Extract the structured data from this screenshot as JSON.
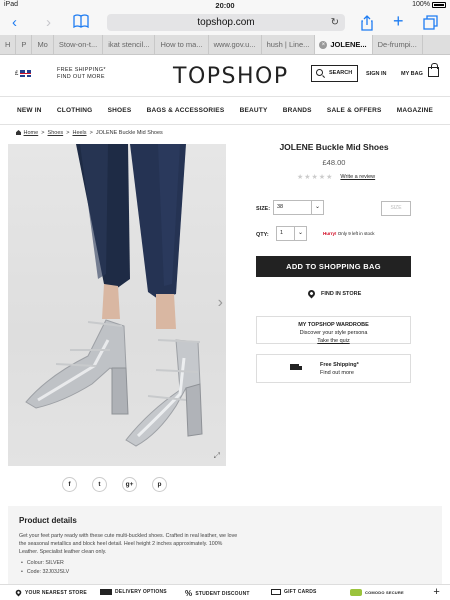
{
  "status_bar": {
    "carrier": "iPad",
    "time": "20:00",
    "battery": "100%"
  },
  "browser": {
    "url": "topshop.com",
    "tabs": [
      "H",
      "P",
      "Mo",
      "Stow-on-t...",
      "ikat stencil...",
      "How to ma...",
      "www.gov.u...",
      "hush | Line...",
      "JOLENE...",
      "De-frumpi..."
    ],
    "active_tab_index": 8
  },
  "header": {
    "currency": "£",
    "shipping_promo_line1": "FREE SHIPPING*",
    "shipping_promo_line2": "FIND OUT MORE",
    "logo": "TOPSHOP",
    "search_label": "SEARCH",
    "signin_label": "SIGN IN",
    "bag_label": "MY BAG"
  },
  "nav": [
    "NEW IN",
    "CLOTHING",
    "SHOES",
    "BAGS & ACCESSORIES",
    "BEAUTY",
    "BRANDS",
    "SALE & OFFERS",
    "MAGAZINE"
  ],
  "breadcrumb": {
    "home": "Home",
    "shoes": "Shoes",
    "heels": "Heels",
    "current": "JOLENE Buckle Mid Shoes"
  },
  "product": {
    "title": "JOLENE Buckle Mid Shoes",
    "price": "£48.00",
    "stars": "★★★★★",
    "review_link": "Write a review",
    "size_label": "SIZE:",
    "size_value": "38",
    "size_guide": "SIZE",
    "qty_label": "QTY:",
    "qty_value": "1",
    "stock_hurry": "Hurry!",
    "stock_text": "Only 9 left in stock",
    "add_to_bag": "ADD TO SHOPPING BAG",
    "find_in_store": "FIND IN STORE",
    "wardrobe_title": "MY TOPSHOP WARDROBE",
    "wardrobe_sub": "Discover your style persona",
    "wardrobe_link": "Take the quiz",
    "free_shipping_title": "Free Shipping*",
    "free_shipping_link": "Find out more"
  },
  "social": [
    "f",
    "t",
    "g+",
    "p"
  ],
  "details": {
    "heading": "Product details",
    "description": "Get your feet party ready with these cute multi-buckled shoes. Crafted in real leather, we love the seasonal metallics and block heel detail. Heel height 2 inches approximately. 100% Leather. Specialist leather clean only.",
    "colour": "Colour:  SILVER",
    "code": "Code:  32J03JSLV"
  },
  "footer": {
    "store": "YOUR NEAREST STORE",
    "delivery": "DELIVERY OPTIONS",
    "student": "STUDENT DISCOUNT",
    "gift": "GIFT CARDS",
    "comodo": "COMODO SECURE"
  },
  "colors": {
    "accent_ios": "#1e7cf2",
    "button_dark": "#222222",
    "hurry_red": "#d0021b",
    "panel_grey": "#f4f4f4"
  }
}
